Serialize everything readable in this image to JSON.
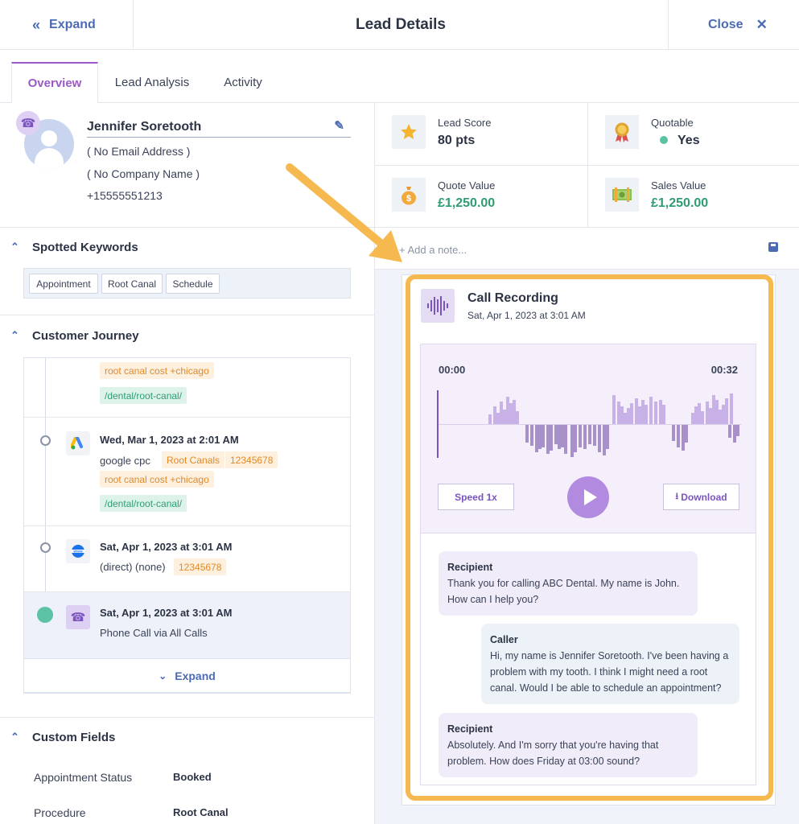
{
  "header": {
    "expand_label": "Expand",
    "title": "Lead Details",
    "close_label": "Close"
  },
  "tabs": [
    {
      "label": "Overview",
      "active": true
    },
    {
      "label": "Lead Analysis",
      "active": false
    },
    {
      "label": "Activity",
      "active": false
    }
  ],
  "profile": {
    "name": "Jennifer Soretooth",
    "email": "( No Email Address )",
    "company": "( No Company Name )",
    "phone": "+15555551213"
  },
  "keywords": {
    "title": "Spotted Keywords",
    "items": [
      "Appointment",
      "Root Canal",
      "Schedule"
    ]
  },
  "journey": {
    "title": "Customer Journey",
    "entries": [
      {
        "date": "",
        "tags": [
          "root canal cost +chicago"
        ],
        "url": "/dental/root-canal/"
      },
      {
        "date": "Wed, Mar 1, 2023 at 2:01 AM",
        "source": "google cpc",
        "tags": [
          "Root Canals",
          "12345678",
          "root canal cost +chicago"
        ],
        "url": "/dental/root-canal/",
        "icon": "google-ads-icon"
      },
      {
        "date": "Sat, Apr 1, 2023 at 3:01 AM",
        "source": "(direct) (none)",
        "tags": [
          "12345678"
        ],
        "icon": "www-icon"
      },
      {
        "date": "Sat, Apr 1, 2023 at 3:01 AM",
        "source": "Phone Call via All Calls",
        "icon": "phone-icon",
        "active": true
      }
    ],
    "expand_label": "Expand"
  },
  "custom_fields": {
    "title": "Custom Fields",
    "items": [
      {
        "label": "Appointment Status",
        "value": "Booked"
      },
      {
        "label": "Procedure",
        "value": "Root Canal"
      }
    ]
  },
  "stats": {
    "lead_score": {
      "label": "Lead Score",
      "value": "80 pts",
      "icon": "star-icon"
    },
    "quotable": {
      "label": "Quotable",
      "value": "Yes",
      "icon": "award-icon"
    },
    "quote_value": {
      "label": "Quote Value",
      "value": "£1,250.00",
      "icon": "money-bag-icon"
    },
    "sales_value": {
      "label": "Sales Value",
      "value": "£1,250.00",
      "icon": "cash-icon"
    }
  },
  "note": {
    "placeholder": "+ Add a note..."
  },
  "recording": {
    "title": "Call Recording",
    "date": "Sat, Apr 1, 2023 at 3:01 AM",
    "time_start": "00:00",
    "time_end": "00:32",
    "speed_label": "Speed 1x",
    "download_label": "Download"
  },
  "transcript": [
    {
      "speaker": "Recipient",
      "text": "Thank you for calling ABC Dental. My name is John. How can I help you?"
    },
    {
      "speaker": "Caller",
      "text": "Hi, my name is Jennifer Soretooth. I've been having a problem with my tooth. I think I might need a root canal. Would I be able to schedule an appointment?"
    },
    {
      "speaker": "Recipient",
      "text": "Absolutely. And I'm sorry that you're having that problem. How does Friday at 03:00 sound?"
    }
  ],
  "colors": {
    "accent_blue": "#4c6bb5",
    "accent_purple": "#9b59c5",
    "highlight": "#f5b94f",
    "green": "#2f9d72",
    "tag_orange": "#e08a2b"
  }
}
